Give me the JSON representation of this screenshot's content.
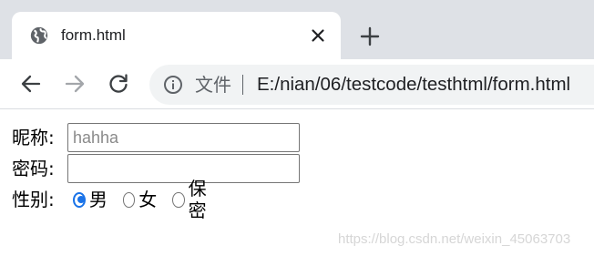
{
  "browser": {
    "tab": {
      "title": "form.html",
      "favicon": "globe-icon"
    },
    "new_tab_icon": "plus-icon",
    "toolbar": {
      "back_icon": "arrow-left-icon",
      "forward_icon": "arrow-right-icon",
      "reload_icon": "reload-icon",
      "security_icon": "info-icon",
      "security_label": "文件",
      "url": "E:/nian/06/testcode/testhtml/form.html"
    }
  },
  "form": {
    "nickname": {
      "label": "昵称:",
      "placeholder": "hahha",
      "value": ""
    },
    "password": {
      "label": "密码:",
      "value": ""
    },
    "gender": {
      "label": "性别:",
      "options": [
        {
          "label": "男",
          "checked": true
        },
        {
          "label": "女",
          "checked": false
        },
        {
          "label": "保密",
          "checked": false
        }
      ]
    }
  },
  "watermark": "https://blog.csdn.net/weixin_45063703",
  "colors": {
    "tab_strip": "#dee1e6",
    "omnibox": "#f1f3f4",
    "radio_accent": "#1a73e8"
  }
}
